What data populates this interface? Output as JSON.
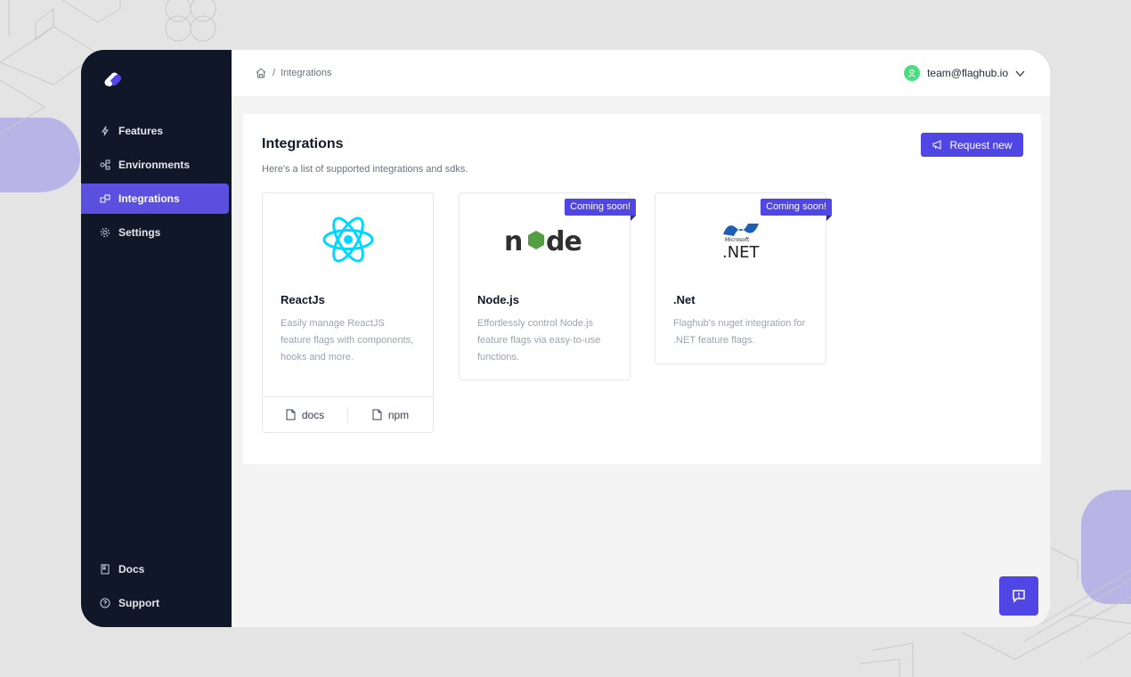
{
  "breadcrumb": {
    "current": "Integrations",
    "separator": "/"
  },
  "user": {
    "email": "team@flaghub.io"
  },
  "sidebar": {
    "items": [
      {
        "label": "Features",
        "icon": "lightning-icon"
      },
      {
        "label": "Environments",
        "icon": "environments-icon"
      },
      {
        "label": "Integrations",
        "icon": "integrations-icon",
        "active": true
      },
      {
        "label": "Settings",
        "icon": "gear-icon"
      }
    ],
    "bottom": [
      {
        "label": "Docs",
        "icon": "book-icon"
      },
      {
        "label": "Support",
        "icon": "help-circle-icon"
      }
    ]
  },
  "page": {
    "title": "Integrations",
    "subtitle": "Here's a list of supported integrations and sdks.",
    "request_button": "Request new"
  },
  "cards": [
    {
      "name": "ReactJs",
      "description": "Easily manage ReactJS feature flags with components, hooks and more.",
      "logo": "react-logo",
      "links": [
        "docs",
        "npm"
      ]
    },
    {
      "name": "Node.js",
      "description": "Effortlessly control Node.js feature flags via easy-to-use functions.",
      "logo": "nodejs-logo",
      "logo_text": "node",
      "badge": "Coming soon!"
    },
    {
      "name": ".Net",
      "description": "Flaghub's nuget integration for .NET feature flags.",
      "logo": "dotnet-logo",
      "logo_text": ".NET",
      "logo_sub": "Microsoft",
      "badge": "Coming soon!"
    }
  ],
  "colors": {
    "accent": "#4f46e5",
    "sidebar_bg": "#0f1728",
    "active_nav": "#5b4fe0",
    "react": "#00d8ff",
    "node_green": "#539e43"
  }
}
